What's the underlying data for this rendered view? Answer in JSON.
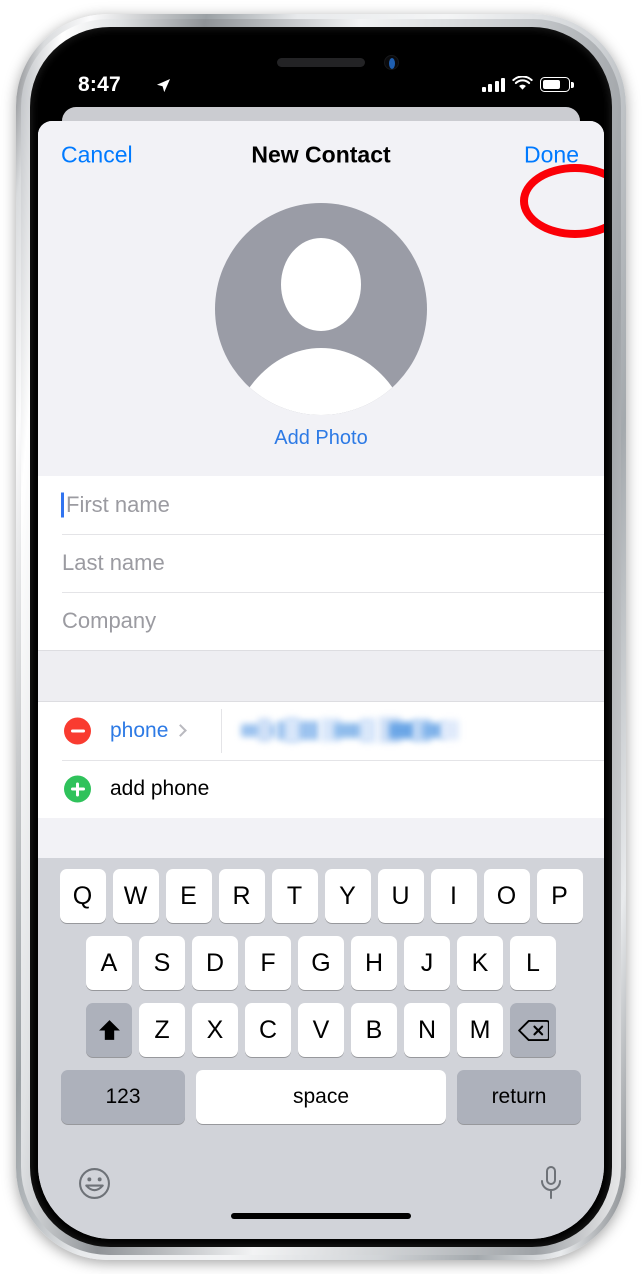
{
  "status_bar": {
    "time": "8:47",
    "location_icon": "location-arrow-icon",
    "signal_icon": "cellular-signal-icon",
    "signal_bars_filled": 3,
    "signal_bars_total": 4,
    "wifi_icon": "wifi-icon",
    "battery_icon": "battery-icon",
    "battery_level_percent": 70
  },
  "nav_bar": {
    "cancel_label": "Cancel",
    "title": "New Contact",
    "done_label": "Done"
  },
  "photo": {
    "avatar_icon": "person-placeholder-icon",
    "add_photo_label": "Add Photo"
  },
  "form": {
    "fields": [
      {
        "placeholder": "First name",
        "value": "",
        "focused": true
      },
      {
        "placeholder": "Last name",
        "value": "",
        "focused": false
      },
      {
        "placeholder": "Company",
        "value": "",
        "focused": false
      }
    ]
  },
  "phone_section": {
    "remove_icon": "minus-circle-icon",
    "label": "phone",
    "disclosure_icon": "chevron-right-icon",
    "value": "",
    "value_redacted": true,
    "add_icon": "plus-circle-icon",
    "add_label": "add phone"
  },
  "keyboard": {
    "row1": [
      "Q",
      "W",
      "E",
      "R",
      "T",
      "Y",
      "U",
      "I",
      "O",
      "P"
    ],
    "row2": [
      "A",
      "S",
      "D",
      "F",
      "G",
      "H",
      "J",
      "K",
      "L"
    ],
    "row3": [
      "Z",
      "X",
      "C",
      "V",
      "B",
      "N",
      "M"
    ],
    "shift_icon": "shift-arrow-icon",
    "backspace_icon": "backspace-icon",
    "numbers_label": "123",
    "space_label": "space",
    "return_label": "return",
    "emoji_icon": "emoji-smiley-icon",
    "mic_icon": "microphone-icon"
  },
  "annotation": {
    "shape": "ellipse",
    "color": "#fb0007",
    "target": "Done"
  },
  "colors": {
    "accent_blue": "#007aff",
    "link_blue": "#2d7ae5",
    "remove_red": "#f93b30",
    "add_green": "#2fc25b",
    "sheet_bg": "#f2f2f6",
    "keyboard_bg": "#d1d3d9",
    "annotation_red": "#fb0007"
  }
}
